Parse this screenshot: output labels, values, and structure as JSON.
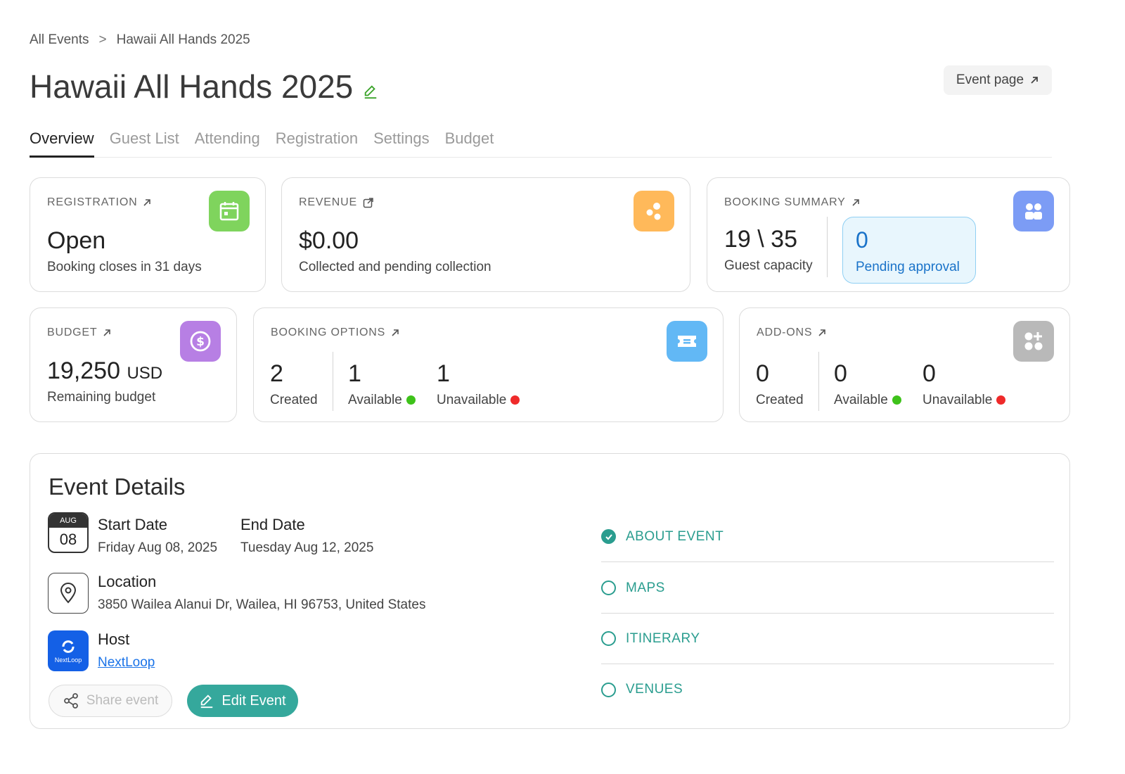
{
  "breadcrumb": {
    "root": "All Events",
    "separator": ">",
    "current": "Hawaii All Hands 2025"
  },
  "page": {
    "title": "Hawaii All Hands 2025",
    "event_page_label": "Event page"
  },
  "tabs": [
    {
      "label": "Overview",
      "active": true
    },
    {
      "label": "Guest List",
      "active": false
    },
    {
      "label": "Attending",
      "active": false
    },
    {
      "label": "Registration",
      "active": false
    },
    {
      "label": "Settings",
      "active": false
    },
    {
      "label": "Budget",
      "active": false
    }
  ],
  "cards": {
    "registration": {
      "label": "REGISTRATION",
      "status": "Open",
      "note": "Booking closes in 31 days",
      "icon": "calendar-icon",
      "color": "#7fd45d"
    },
    "revenue": {
      "label": "REVENUE",
      "amount": "$0.00",
      "note": "Collected and pending collection",
      "icon": "dots-icon",
      "color": "#ffb95a"
    },
    "booking_summary": {
      "label": "BOOKING SUMMARY",
      "capacity": "19 \\ 35",
      "capacity_label": "Guest capacity",
      "pending_count": "0",
      "pending_label": "Pending approval",
      "icon": "grid-icon",
      "color": "#7c9cf5"
    },
    "budget": {
      "label": "BUDGET",
      "amount": "19,250",
      "currency": "USD",
      "note": "Remaining budget",
      "icon": "dollar-icon",
      "color": "#b77fe4"
    },
    "booking_options": {
      "label": "BOOKING OPTIONS",
      "created": "2",
      "created_label": "Created",
      "available": "1",
      "available_label": "Available",
      "unavailable": "1",
      "unavailable_label": "Unavailable",
      "icon": "ticket-icon",
      "color": "#62b8f5"
    },
    "addons": {
      "label": "ADD-ONS",
      "created": "0",
      "created_label": "Created",
      "available": "0",
      "available_label": "Available",
      "unavailable": "0",
      "unavailable_label": "Unavailable",
      "icon": "add-grid-icon",
      "color": "#b9b9b9"
    }
  },
  "status_colors": {
    "available": "#3ec21a",
    "unavailable": "#ef2a2a",
    "accent": "#35a89c"
  },
  "details": {
    "title": "Event Details",
    "calendar": {
      "month": "AUG",
      "day": "08"
    },
    "start_label": "Start Date",
    "start_value": "Friday Aug 08, 2025",
    "end_label": "End Date",
    "end_value": "Tuesday Aug 12, 2025",
    "location_label": "Location",
    "location_value": "3850 Wailea Alanui Dr, Wailea, HI 96753, United States",
    "host_label": "Host",
    "host_value": "NextLoop",
    "host_logo_text": "NextLoop",
    "share_label": "Share event",
    "edit_label": "Edit Event"
  },
  "sections": [
    {
      "label": "ABOUT EVENT",
      "checked": true
    },
    {
      "label": "MAPS",
      "checked": false
    },
    {
      "label": "ITINERARY",
      "checked": false
    },
    {
      "label": "VENUES",
      "checked": false
    }
  ]
}
